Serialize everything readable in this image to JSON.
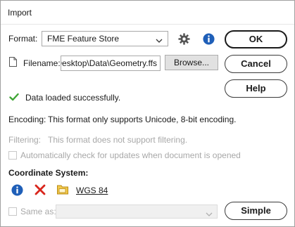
{
  "window": {
    "title": "Import"
  },
  "format": {
    "label": "Format:",
    "value": "FME Feature Store",
    "settings_icon": "gear-icon",
    "info_icon": "info-icon"
  },
  "filename": {
    "label": "Filename:",
    "value": "\\Desktop\\Data\\Geometry.ffs",
    "browse_label": "Browse..."
  },
  "buttons": {
    "ok": "OK",
    "cancel": "Cancel",
    "help": "Help",
    "simple": "Simple"
  },
  "status": {
    "message": "Data loaded successfully.",
    "icon": "checkmark-icon",
    "color": "#3fa535"
  },
  "encoding": {
    "label": "Encoding:",
    "text": "This format only supports Unicode, 8-bit encoding."
  },
  "filtering": {
    "label": "Filtering:",
    "text": "This format does not support filtering.",
    "enabled": false
  },
  "auto_check": {
    "label": "Automatically check for updates when document is opened",
    "checked": false,
    "enabled": false
  },
  "coordinate_system": {
    "heading": "Coordinate System:",
    "value": "WGS 84",
    "same_as_label": "Same as:",
    "same_as_checked": false,
    "same_as_enabled": false
  },
  "colors": {
    "info_blue": "#1f5fb8",
    "delete_red": "#d9261c",
    "folder_yellow": "#f2c94c",
    "disabled_text": "#a8a8a8"
  }
}
